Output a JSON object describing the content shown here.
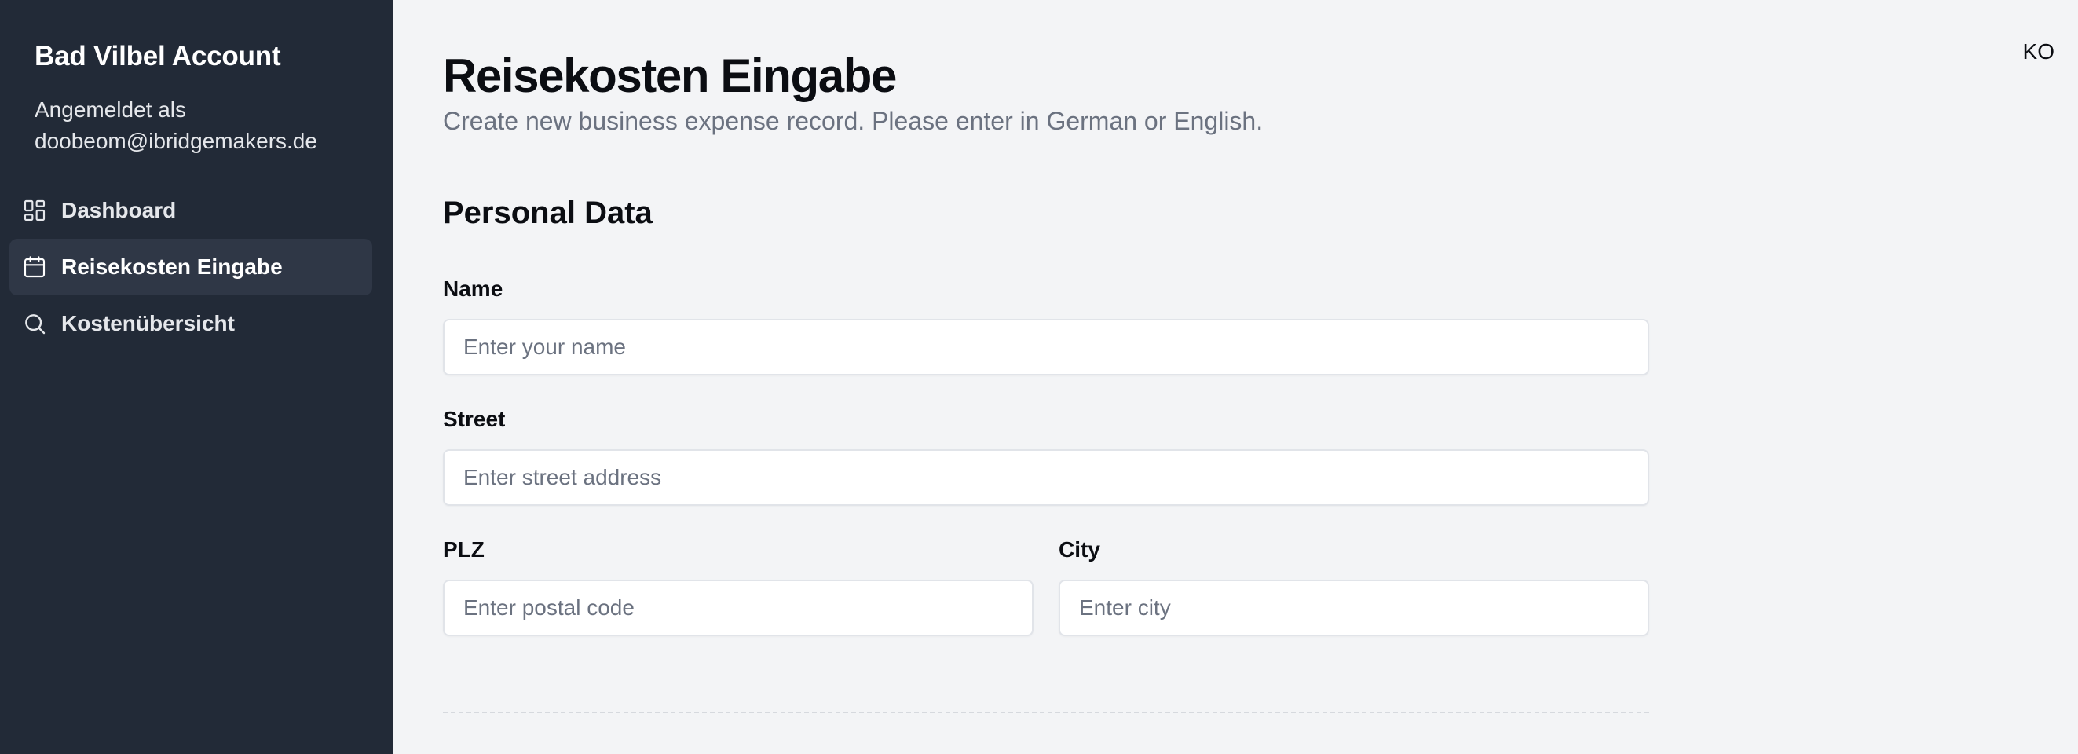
{
  "sidebar": {
    "brand": "Bad Vilbel Account",
    "signed_in_label": "Angemeldet als",
    "signed_in_email": "doobeom@ibridgemakers.de",
    "items": [
      {
        "label": "Dashboard",
        "icon": "dashboard-icon",
        "active": false
      },
      {
        "label": "Reisekosten Eingabe",
        "icon": "calendar-icon",
        "active": true
      },
      {
        "label": "Kostenübersicht",
        "icon": "search-icon",
        "active": false
      }
    ]
  },
  "header": {
    "user_initials": "KO"
  },
  "main": {
    "title": "Reisekosten Eingabe",
    "subtitle": "Create new business expense record. Please enter in German or English.",
    "section_title": "Personal Data",
    "fields": {
      "name": {
        "label": "Name",
        "placeholder": "Enter your name",
        "value": ""
      },
      "street": {
        "label": "Street",
        "placeholder": "Enter street address",
        "value": ""
      },
      "plz": {
        "label": "PLZ",
        "placeholder": "Enter postal code",
        "value": ""
      },
      "city": {
        "label": "City",
        "placeholder": "Enter city",
        "value": ""
      }
    }
  },
  "colors": {
    "sidebar_bg": "#222a37",
    "sidebar_active_bg": "#2f3746",
    "page_bg": "#f3f4f6",
    "subtitle_text": "#6b7280"
  }
}
